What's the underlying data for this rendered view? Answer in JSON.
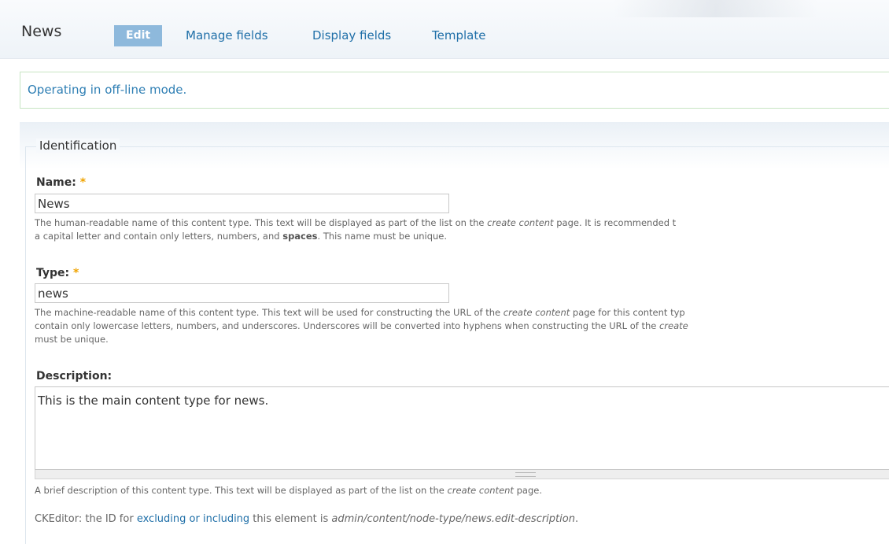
{
  "header": {
    "title": "News",
    "tabs": [
      {
        "label": "Edit",
        "active": true
      },
      {
        "label": "Manage fields",
        "active": false
      },
      {
        "label": "Display fields",
        "active": false
      },
      {
        "label": "Template",
        "active": false
      }
    ]
  },
  "status_message": "Operating in off-line mode.",
  "fieldset": {
    "legend": "Identification",
    "name": {
      "label": "Name:",
      "required_marker": "*",
      "value": "News",
      "help_1": "The human-readable name of this content type. This text will be displayed as part of the list on the ",
      "help_em": "create content",
      "help_2": " page. It is recommended t",
      "help_3": "a capital letter and contain only letters, numbers, and ",
      "help_strong": "spaces",
      "help_4": ". This name must be unique."
    },
    "type": {
      "label": "Type:",
      "required_marker": "*",
      "value": "news",
      "help_1": "The machine-readable name of this content type. This text will be used for constructing the URL of the ",
      "help_em": "create content",
      "help_2": " page for this content typ",
      "help_3": "contain only lowercase letters, numbers, and underscores. Underscores will be converted into hyphens when constructing the URL of the ",
      "help_em2": "create",
      "help_4": "must be unique."
    },
    "description": {
      "label": "Description:",
      "value": "This is the main content type for news.",
      "help_1": "A brief description of this content type. This text will be displayed as part of the list on the ",
      "help_em": "create content",
      "help_2": " page.",
      "cke_1": "CKEditor: the ID for ",
      "cke_link": "excluding or including",
      "cke_2": " this element is ",
      "cke_id": "admin/content/node-type/news.edit-description",
      "cke_3": "."
    }
  },
  "colors": {
    "link": "#1f6fa8",
    "active_tab_bg": "#8eb9dc",
    "required": "#f0a300",
    "status_border": "#c7e5c3"
  }
}
